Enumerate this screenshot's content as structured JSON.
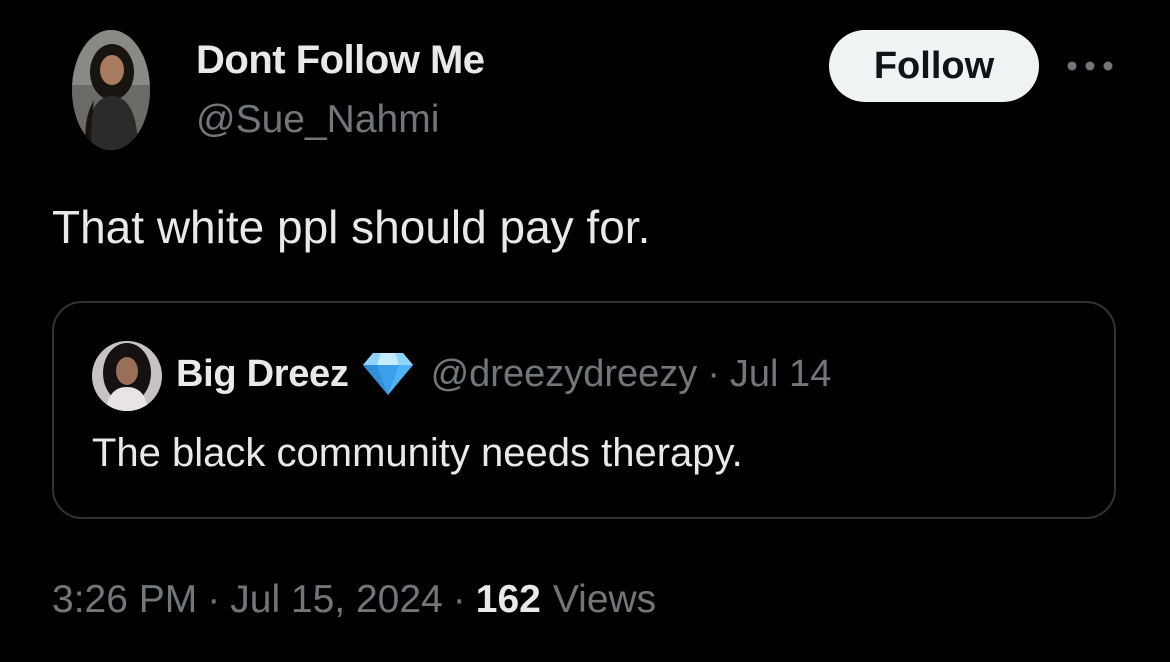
{
  "tweet": {
    "author": {
      "display_name": "Dont Follow Me",
      "handle": "@Sue_Nahmi",
      "avatar_icon": "profile-photo"
    },
    "follow_label": "Follow",
    "more_icon": "more-horizontal-icon",
    "text": "That white ppl should pay for.",
    "timestamp": "3:26 PM",
    "separator": "·",
    "date": "Jul 15, 2024",
    "views_count": "162",
    "views_label": "Views"
  },
  "quoted_tweet": {
    "display_name": "Big Dreez",
    "badge_icon": "diamond-emoji",
    "handle": "@dreezydreezy",
    "separator": "·",
    "date": "Jul 14",
    "text": "The black community needs therapy."
  },
  "colors": {
    "background": "#000000",
    "primary_text": "#e7e9ea",
    "secondary_text": "#71767b",
    "border": "#2f3336",
    "follow_button_bg": "#eff3f4",
    "diamond": "#4fb3f6"
  }
}
